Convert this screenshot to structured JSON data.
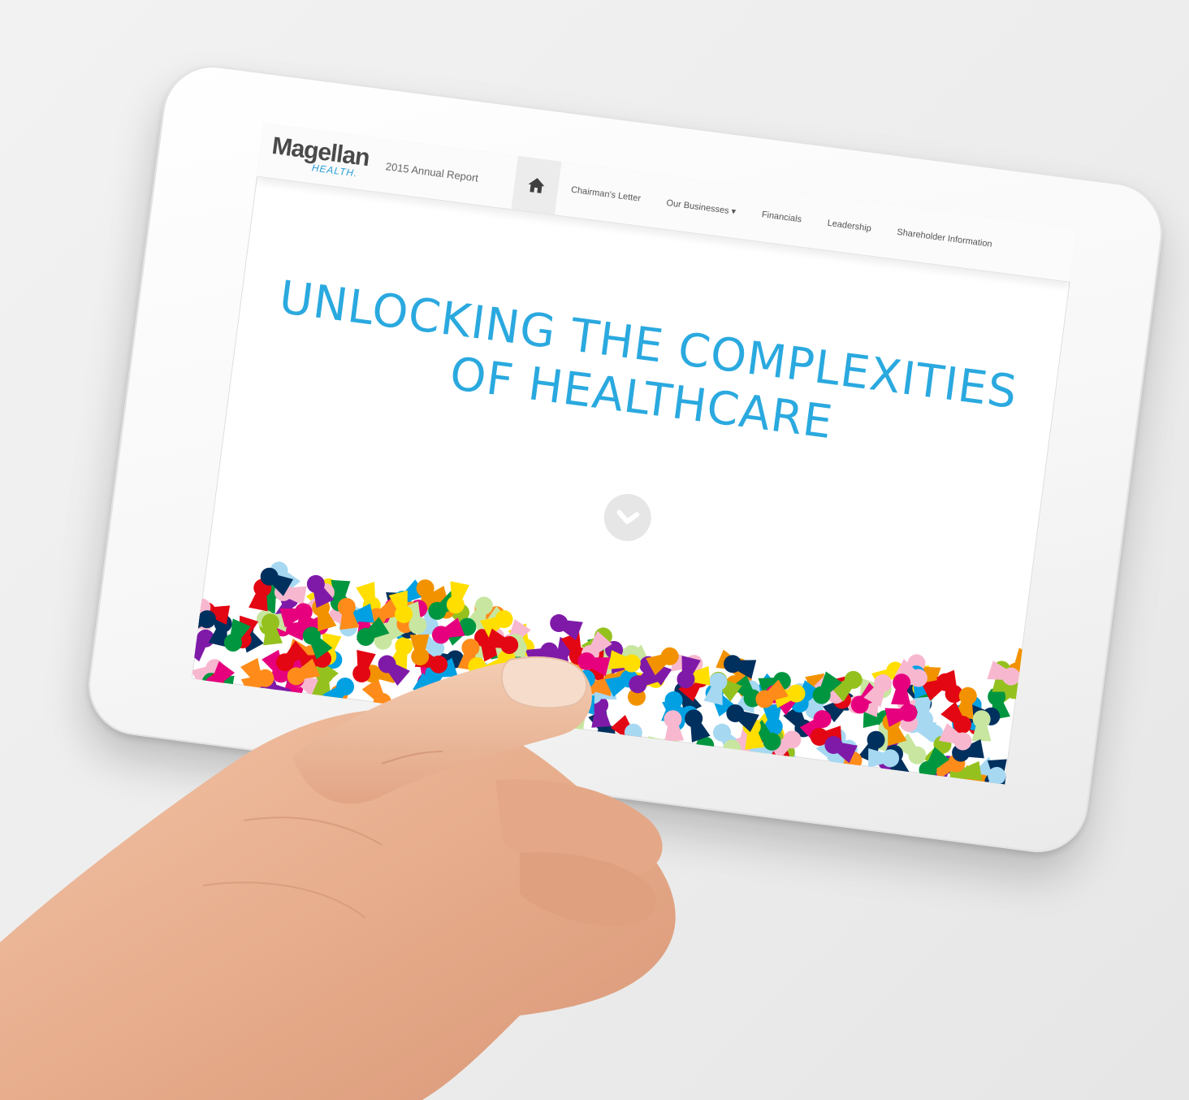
{
  "logo": {
    "main": "Magellan",
    "sub": "HEALTH."
  },
  "header": {
    "report_title": "2015 Annual Report",
    "home_icon": "home-icon",
    "nav": [
      {
        "label": "Chairman's Letter"
      },
      {
        "label": "Our Businesses ▾"
      },
      {
        "label": "Financials"
      },
      {
        "label": "Leadership"
      },
      {
        "label": "Shareholder Information"
      }
    ]
  },
  "hero": {
    "line1": "UNLOCKING THE COMPLEXITIES",
    "line2": "OF HEALTHCARE",
    "scroll_icon": "chevron-down-icon"
  },
  "colors": {
    "accent": "#2aa9df",
    "confetti": [
      "#e6007e",
      "#00a0e3",
      "#f39200",
      "#009640",
      "#ffde00",
      "#7f1aa8",
      "#e30613",
      "#00305e",
      "#95c11f",
      "#a6d8f2",
      "#f7b8cf",
      "#c8e6a0",
      "#ff8c1a"
    ]
  }
}
